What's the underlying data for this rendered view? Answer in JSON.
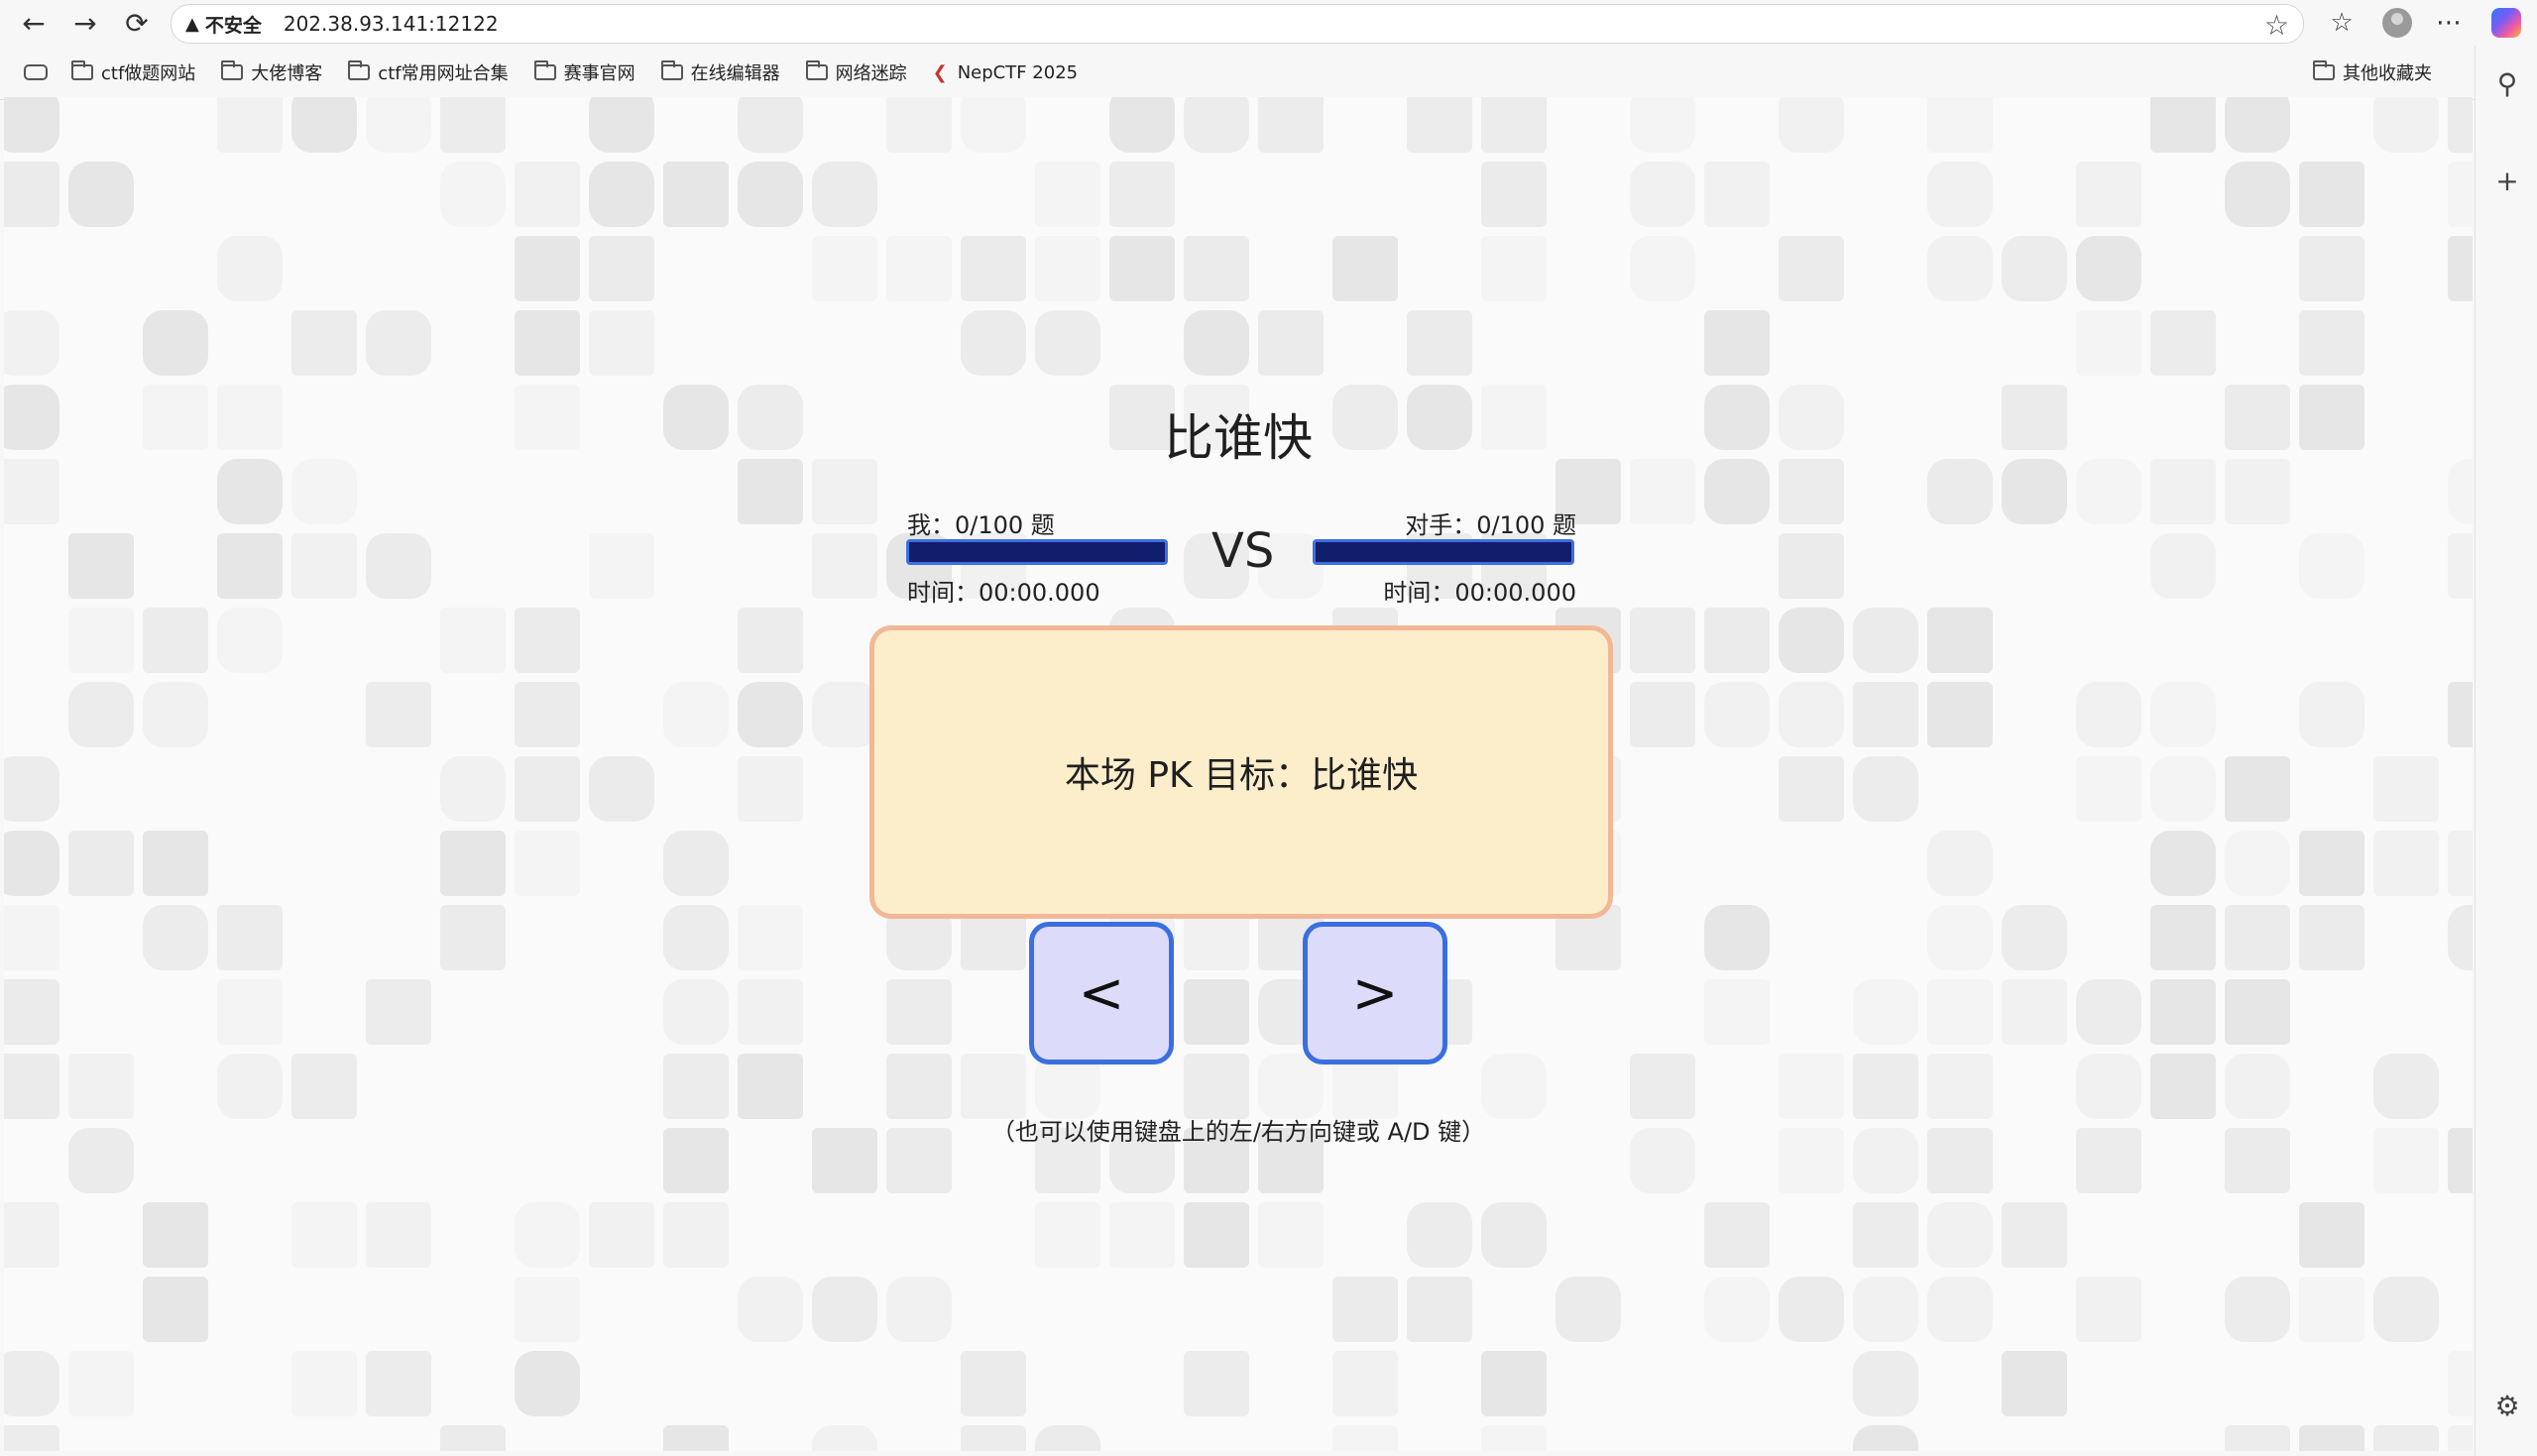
{
  "browser": {
    "security_label": "不安全",
    "url": "202.38.93.141:12122",
    "bookmarks": [
      {
        "label": "ctf做题网站",
        "icon": "folder-icon"
      },
      {
        "label": "大佬博客",
        "icon": "folder-icon"
      },
      {
        "label": "ctf常用网址合集",
        "icon": "folder-icon"
      },
      {
        "label": "赛事官网",
        "icon": "folder-icon"
      },
      {
        "label": "在线编辑器",
        "icon": "folder-icon"
      },
      {
        "label": "网络迷踪",
        "icon": "folder-icon"
      },
      {
        "label": "NepCTF 2025",
        "icon": "nepctf-favicon"
      }
    ],
    "other_bookmarks": "其他收藏夹"
  },
  "game": {
    "title": "比谁快",
    "me": {
      "label": "我：0/100 题",
      "time": "时间：00:00.000",
      "progress": 0
    },
    "vs": "VS",
    "opponent": {
      "label": "对手：0/100 题",
      "time": "时间：00:00.000",
      "progress": 0
    },
    "goal": "本场 PK 目标：比谁快",
    "left_button": "<",
    "right_button": ">",
    "hint": "（也可以使用键盘上的左/右方向键或 A/D 键）"
  },
  "colors": {
    "goal_box_bg": "#fdeecb",
    "goal_box_border": "#f2b896",
    "button_bg": "#dcdcfa",
    "button_border": "#3a6fe0",
    "progress_bar": "#0f1f6b"
  }
}
